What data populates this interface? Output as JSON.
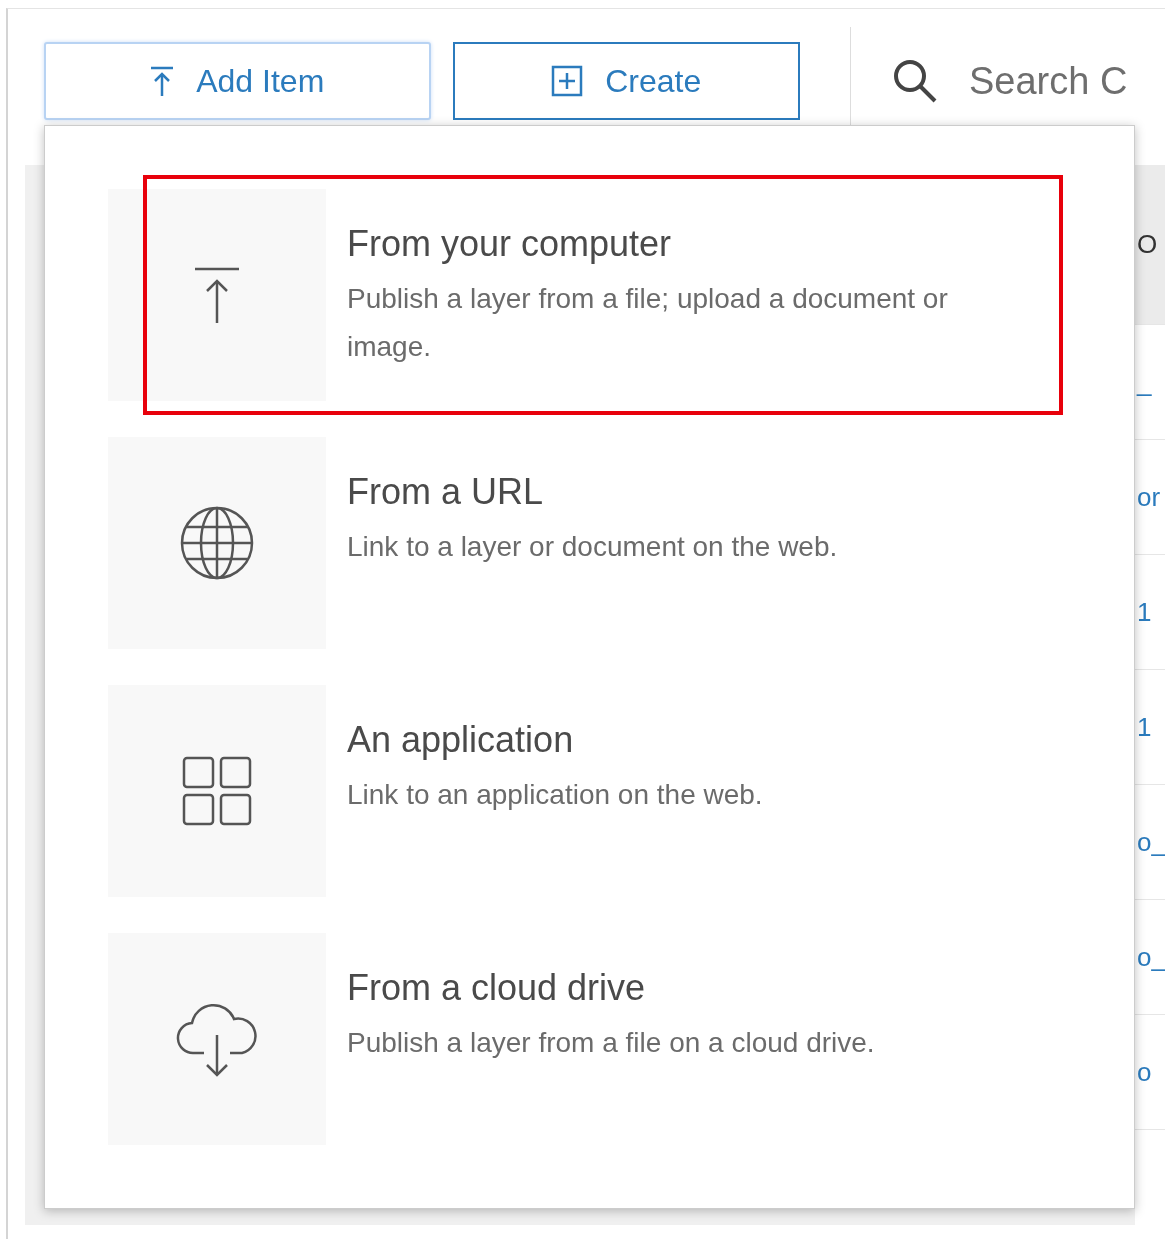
{
  "toolbar": {
    "buttons": [
      {
        "label": "Add Item",
        "kind": "add",
        "selected": true
      },
      {
        "label": "Create",
        "kind": "create",
        "selected": false
      }
    ],
    "search": {
      "placeholder": "Search C"
    }
  },
  "menu": {
    "items": [
      {
        "kind": "upload",
        "title": "From your computer",
        "description": "Publish a layer from a file; upload a document or image.",
        "highlighted": true
      },
      {
        "kind": "url",
        "title": "From a URL",
        "description": "Link to a layer or document on the web.",
        "highlighted": false
      },
      {
        "kind": "application",
        "title": "An application",
        "description": "Link to an application on the web.",
        "highlighted": false
      },
      {
        "kind": "cloud",
        "title": "From a cloud drive",
        "description": "Publish a layer from a file on a cloud drive.",
        "highlighted": false
      }
    ]
  },
  "table": {
    "column_1": {
      "header": "O",
      "cells": [
        "_",
        "or",
        "1",
        "1",
        "o_",
        "o_",
        "o"
      ]
    }
  }
}
